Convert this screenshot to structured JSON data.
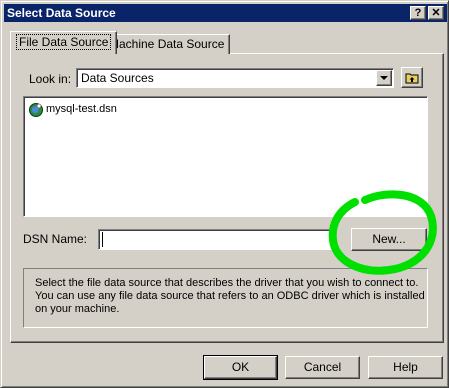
{
  "window": {
    "title": "Select Data Source",
    "help_glyph": "?",
    "close_glyph": "✕"
  },
  "tabs": [
    {
      "label": "File Data Source",
      "active": true
    },
    {
      "label": "Machine Data Source",
      "active": false
    }
  ],
  "look_in": {
    "label": "Look in:",
    "value": "Data Sources"
  },
  "files": [
    {
      "name": "mysql-test.dsn",
      "icon": "dsn-file-icon"
    }
  ],
  "dsn_name": {
    "label": "DSN Name:",
    "value": ""
  },
  "buttons": {
    "new": "New...",
    "ok": "OK",
    "cancel": "Cancel",
    "help": "Help"
  },
  "description": "Select the file data source that describes the driver that you wish to connect to. You can use any file data source that refers to an ODBC driver which is installed on your machine.",
  "annotation": {
    "color": "#00e000"
  }
}
